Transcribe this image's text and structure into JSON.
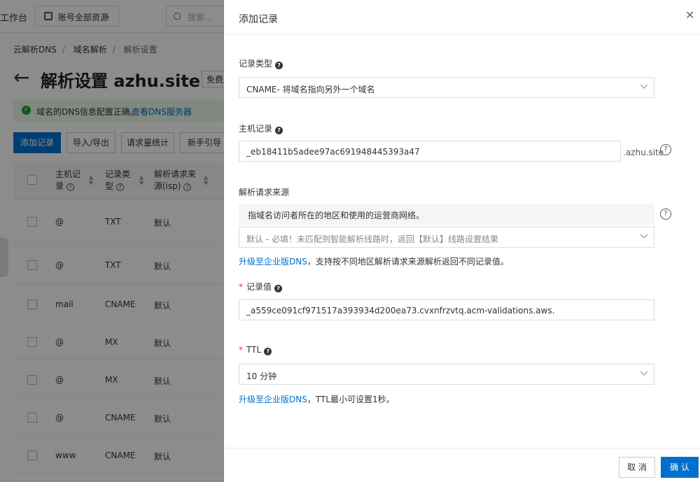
{
  "topbar": {
    "workbench": "工作台",
    "account_select": "账号全部资源",
    "search_placeholder": "搜索..."
  },
  "breadcrumb": [
    "云解析DNS",
    "域名解析",
    "解析设置"
  ],
  "page": {
    "title": "解析设置 azhu.site",
    "tag": "免费版"
  },
  "alert": {
    "message": "域名的DNS信息配置正确。",
    "link": "查看DNS服务器"
  },
  "toolbar": {
    "add": "添加记录",
    "import_export": "导入/导出",
    "stats": "请求量统计",
    "guide": "新手引导"
  },
  "table": {
    "headers": [
      "主机记录",
      "记录类型",
      "解析请求来源(isp)"
    ],
    "rows": [
      {
        "host": "@",
        "type": "TXT",
        "line": "默认"
      },
      {
        "host": "@",
        "type": "TXT",
        "line": "默认"
      },
      {
        "host": "mail",
        "type": "CNAME",
        "line": "默认"
      },
      {
        "host": "@",
        "type": "MX",
        "line": "默认"
      },
      {
        "host": "@",
        "type": "MX",
        "line": "默认"
      },
      {
        "host": "@",
        "type": "CNAME",
        "line": "默认"
      },
      {
        "host": "www",
        "type": "CNAME",
        "line": "默认"
      }
    ]
  },
  "drawer": {
    "title": "添加记录",
    "record_type": {
      "label": "记录类型",
      "value": "CNAME- 将域名指向另外一个域名"
    },
    "host": {
      "label": "主机记录",
      "value": "_eb18411b5adee97ac691948445393a47",
      "suffix": ".azhu.site"
    },
    "isp": {
      "label": "解析请求来源",
      "note": "指域名访问者所在的地区和使用的运营商网络。",
      "value": "默认 - 必填！未匹配到智能解析线路时，返回【默认】线路设置结果",
      "hint_link": "升级至企业版DNS",
      "hint_text": "，支持按不同地区解析请求来源解析返回不同记录值。"
    },
    "record_value": {
      "label": "记录值",
      "value": "_a559ce091cf971517a393934d200ea73.cvxnfrzvtq.acm-validations.aws."
    },
    "ttl": {
      "label": "TTL",
      "value": "10 分钟",
      "hint_link": "升级至企业版DNS",
      "hint_text": "，TTL最小可设置1秒。"
    },
    "cancel": "取 消",
    "confirm": "确 认"
  }
}
